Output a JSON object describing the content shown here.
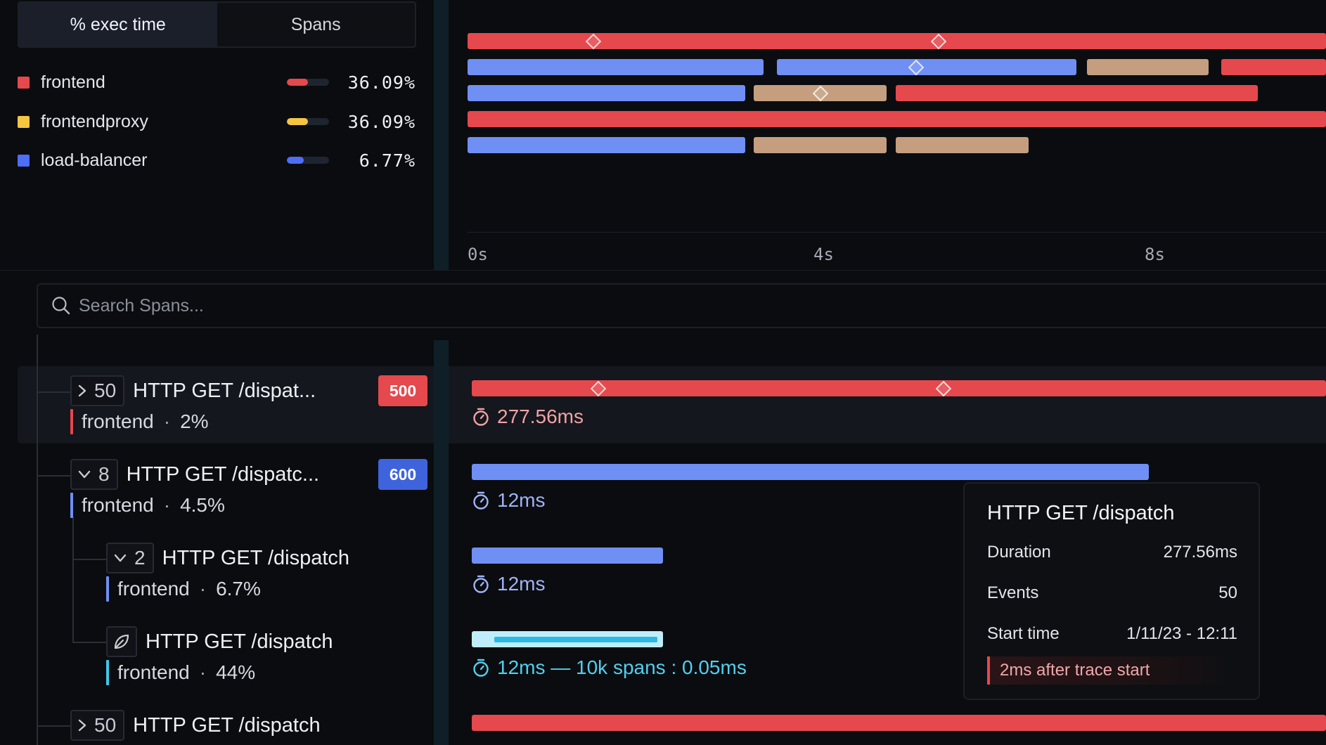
{
  "colors": {
    "red": "#e5484d",
    "yellow": "#f5c542",
    "blue": "#6f8ff5",
    "tan": "#c49e7e",
    "cyan": "#3fc8ea",
    "badge_red": "#e5484d",
    "badge_blue": "#3e63dd"
  },
  "tabs": [
    {
      "label": "% exec time",
      "active": true
    },
    {
      "label": "Spans",
      "active": false
    }
  ],
  "services": [
    {
      "name": "frontend",
      "color": "#e5484d",
      "percent": "36.09%",
      "fraction": 0.5
    },
    {
      "name": "frontendproxy",
      "color": "#f5c542",
      "percent": "36.09%",
      "fraction": 0.5
    },
    {
      "name": "load-balancer",
      "color": "#4d6ef5",
      "percent": "6.77%",
      "fraction": 0.4
    }
  ],
  "axis": {
    "ticks": [
      "0s",
      "4s",
      "8s"
    ]
  },
  "search": {
    "placeholder": "Search Spans..."
  },
  "spans": [
    {
      "count": "50",
      "expanded": false,
      "title": "HTTP GET /dispat...",
      "status": "500",
      "service": "frontend",
      "percent": "2%",
      "duration": "277.56ms"
    },
    {
      "count": "8",
      "expanded": true,
      "title": "HTTP GET /dispatc...",
      "status": "600",
      "service": "frontend",
      "percent": "4.5%",
      "duration": "12ms"
    },
    {
      "count": "2",
      "expanded": true,
      "title": "HTTP GET /dispatch",
      "service": "frontend",
      "percent": "6.7%",
      "duration": "12ms"
    },
    {
      "title": "HTTP GET /dispatch",
      "service": "frontend",
      "percent": "44%",
      "duration": "12ms — 10k spans : 0.05ms"
    },
    {
      "count": "50",
      "expanded": false,
      "title": "HTTP GET /dispatch"
    }
  ],
  "tooltip": {
    "title": "HTTP GET /dispatch",
    "duration_label": "Duration",
    "duration_value": "277.56ms",
    "events_label": "Events",
    "events_value": "50",
    "start_label": "Start time",
    "start_value": "1/11/23 - 12:11",
    "note": "2ms after trace start"
  }
}
